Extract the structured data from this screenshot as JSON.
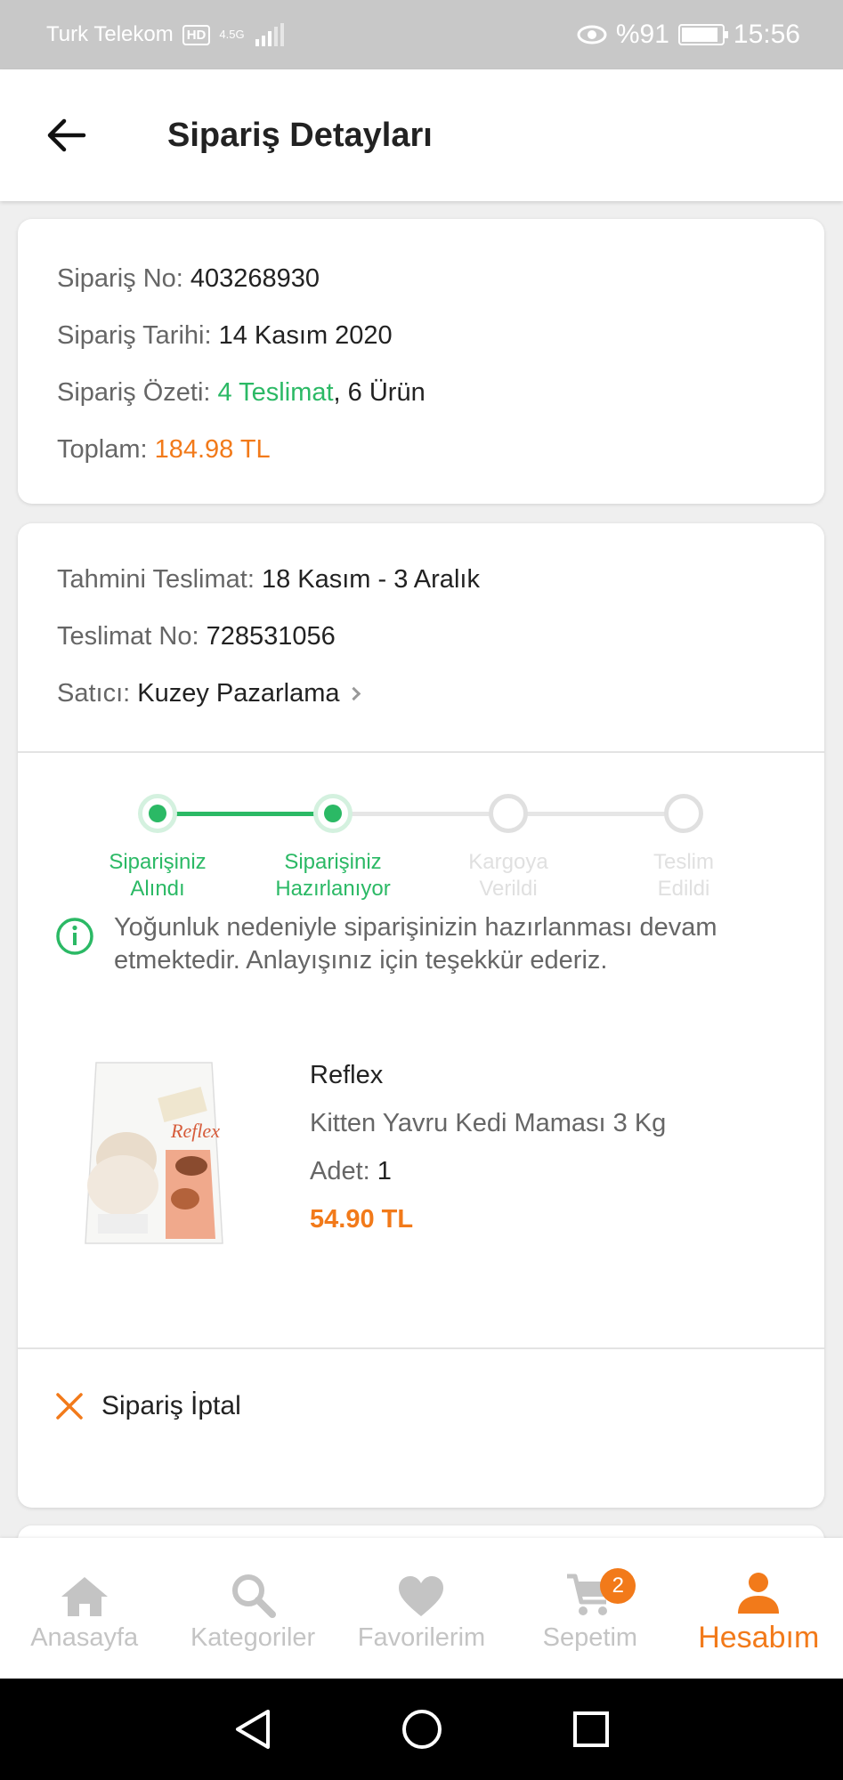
{
  "status_bar": {
    "carrier": "Turk Telekom",
    "hd": "HD",
    "network": "4.5G",
    "battery_percent": "%91",
    "battery_level": 0.91,
    "time": "15:56"
  },
  "header": {
    "title": "Sipariş Detayları"
  },
  "order": {
    "no_label": "Sipariş No:",
    "no_value": "403268930",
    "date_label": "Sipariş Tarihi:",
    "date_value": "14 Kasım 2020",
    "summary_label": "Sipariş Özeti:",
    "summary_deliveries": "4 Teslimat",
    "summary_sep": ",",
    "summary_products": "6 Ürün",
    "total_label": "Toplam:",
    "total_value": "184.98 TL"
  },
  "delivery": {
    "estimated_label": "Tahmini Teslimat:",
    "estimated_value": "18 Kasım - 3 Aralık",
    "no_label": "Teslimat No:",
    "no_value": "728531056",
    "seller_label": "Satıcı:",
    "seller_value": "Kuzey Pazarlama",
    "steps": [
      {
        "line1": "Siparişiniz",
        "line2": "Alındı",
        "done": true
      },
      {
        "line1": "Siparişiniz",
        "line2": "Hazırlanıyor",
        "done": true
      },
      {
        "line1": "Kargoya",
        "line2": "Verildi",
        "done": false
      },
      {
        "line1": "Teslim",
        "line2": "Edildi",
        "done": false
      }
    ],
    "notice": "Yoğunluk nedeniyle siparişinizin hazırlanması devam etmektedir. Anlayışınız için teşekkür ederiz.",
    "product": {
      "brand": "Reflex",
      "name": "Kitten Yavru Kedi Maması 3 Kg",
      "qty_label": "Adet:",
      "qty_value": "1",
      "price": "54.90 TL",
      "image_text": "Reflex"
    },
    "cancel_label": "Sipariş İptal"
  },
  "bottom_nav": {
    "items": [
      {
        "label": "Anasayfa",
        "icon": "home-icon"
      },
      {
        "label": "Kategoriler",
        "icon": "search-icon"
      },
      {
        "label": "Favorilerim",
        "icon": "heart-icon"
      },
      {
        "label": "Sepetim",
        "icon": "cart-icon",
        "badge": "2"
      },
      {
        "label": "Hesabım",
        "icon": "person-icon",
        "active": true
      }
    ]
  },
  "colors": {
    "accent": "#f27a1a",
    "success": "#2bb965",
    "background": "#efefef"
  }
}
